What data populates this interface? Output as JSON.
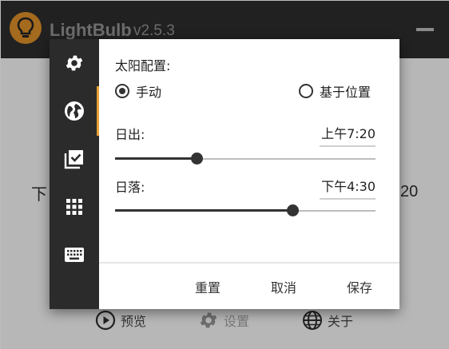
{
  "app": {
    "name": "LightBulb",
    "version": "v2.5.3",
    "clock_left": "下",
    "clock_right": "20"
  },
  "bottom_nav": {
    "preview_label": "预览",
    "settings_label": "设置",
    "about_label": "关于"
  },
  "rail": {
    "icons": [
      "gear-icon",
      "globe-icon",
      "checklist-icon",
      "grid-icon",
      "keyboard-icon"
    ],
    "active_index": 1,
    "accent_color": "#e7a234"
  },
  "solar": {
    "title": "太阳配置:",
    "mode_manual": "手动",
    "mode_location": "基于位置",
    "selected_mode": "manual",
    "sunrise_label": "日出:",
    "sunrise_value": "上午7:20",
    "sunrise_slider_fraction": 0.313,
    "sunset_label": "日落:",
    "sunset_value": "下午4:30",
    "sunset_slider_fraction": 0.681
  },
  "actions": {
    "reset": "重置",
    "cancel": "取消",
    "save": "保存"
  },
  "colors": {
    "titlebar": "#212121",
    "logo": "#a46a1e",
    "rail": "#2b2b2b"
  }
}
